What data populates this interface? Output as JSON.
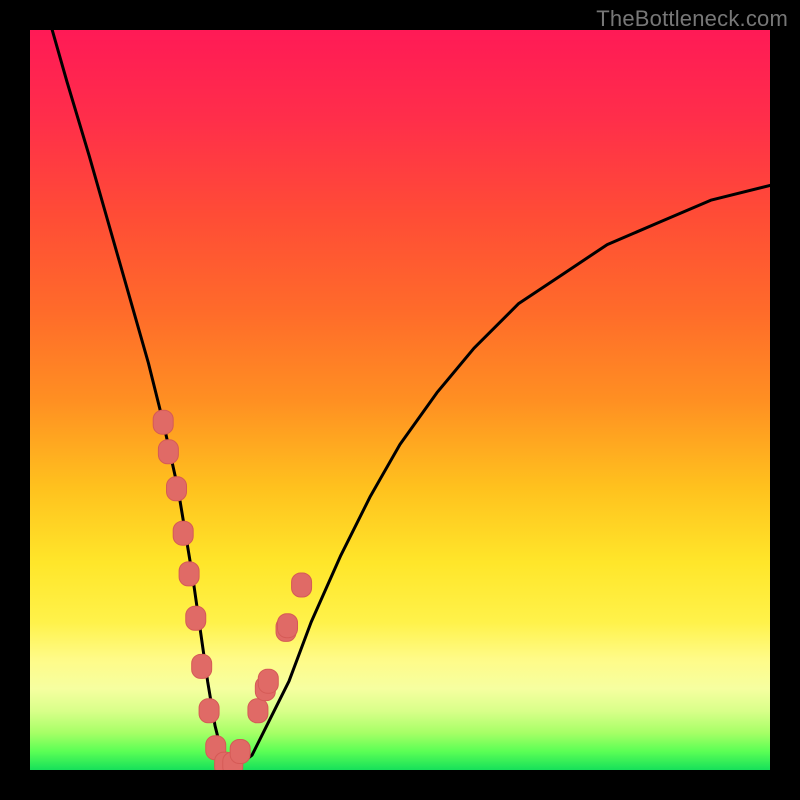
{
  "watermark": "TheBottleneck.com",
  "colors": {
    "frame": "#000000",
    "curve": "#000000",
    "marker_fill": "#e06a66",
    "marker_stroke": "#d55a56",
    "gradient_stops": [
      {
        "offset": 0.0,
        "color": "#ff1a56"
      },
      {
        "offset": 0.12,
        "color": "#ff2e4a"
      },
      {
        "offset": 0.25,
        "color": "#ff4c36"
      },
      {
        "offset": 0.38,
        "color": "#ff6b2a"
      },
      {
        "offset": 0.5,
        "color": "#ff8f22"
      },
      {
        "offset": 0.62,
        "color": "#ffc21e"
      },
      {
        "offset": 0.72,
        "color": "#ffe62a"
      },
      {
        "offset": 0.8,
        "color": "#fff24a"
      },
      {
        "offset": 0.85,
        "color": "#fffb88"
      },
      {
        "offset": 0.89,
        "color": "#f6ffa0"
      },
      {
        "offset": 0.92,
        "color": "#d9ff8a"
      },
      {
        "offset": 0.95,
        "color": "#a6ff66"
      },
      {
        "offset": 0.975,
        "color": "#5bff55"
      },
      {
        "offset": 1.0,
        "color": "#16e05a"
      }
    ]
  },
  "chart_data": {
    "type": "line",
    "title": "",
    "xlabel": "",
    "ylabel": "",
    "xlim": [
      0,
      100
    ],
    "ylim": [
      0,
      100
    ],
    "series": [
      {
        "name": "bottleneck-curve",
        "x": [
          3,
          5,
          8,
          10,
          12,
          14,
          16,
          18,
          20,
          21,
          22,
          23,
          24,
          25,
          26,
          27,
          28,
          30,
          32,
          35,
          38,
          42,
          46,
          50,
          55,
          60,
          66,
          72,
          78,
          85,
          92,
          100
        ],
        "y": [
          100,
          93,
          83,
          76,
          69,
          62,
          55,
          47,
          38,
          32,
          26,
          19,
          12,
          6,
          2,
          0.5,
          0.5,
          2,
          6,
          12,
          20,
          29,
          37,
          44,
          51,
          57,
          63,
          67,
          71,
          74,
          77,
          79
        ]
      }
    ],
    "markers": {
      "name": "highlighted-points",
      "x": [
        18.0,
        18.7,
        19.8,
        20.7,
        21.5,
        22.4,
        23.2,
        24.2,
        25.1,
        26.3,
        27.4,
        28.4,
        30.8,
        31.8,
        32.2,
        34.6,
        34.8,
        36.7
      ],
      "y": [
        47.0,
        43.0,
        38.0,
        32.0,
        26.5,
        20.5,
        14.0,
        8.0,
        3.0,
        0.8,
        0.8,
        2.5,
        8.0,
        11.0,
        12.0,
        19.0,
        19.5,
        25.0
      ]
    }
  }
}
